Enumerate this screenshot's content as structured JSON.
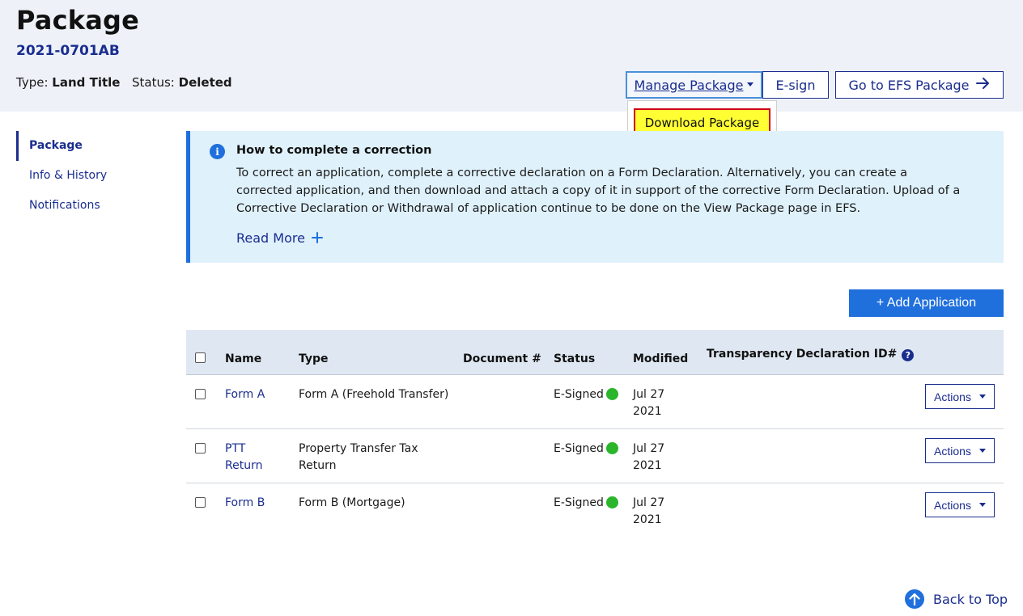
{
  "header": {
    "title": "Package",
    "package_id": "2021-0701AB",
    "type_label": "Type:",
    "type_value": "Land Title",
    "status_label": "Status:",
    "status_value": "Deleted",
    "manage_label": "Manage Package",
    "esign_label": "E-sign",
    "efs_label": "Go to EFS Package",
    "dropdown": {
      "download_label": "Download Package"
    }
  },
  "sidebar": {
    "items": [
      {
        "label": "Package",
        "active": true
      },
      {
        "label": "Info & History",
        "active": false
      },
      {
        "label": "Notifications",
        "active": false
      }
    ]
  },
  "info": {
    "title": "How to complete a correction",
    "body": "To correct an application, complete a corrective declaration on a Form Declaration. Alternatively, you can create a corrected application, and then download and attach a copy of it in support of the corrective Form Declaration. Upload of a Corrective Declaration or Withdrawal of application continue to be done on the View Package page in EFS.",
    "read_more": "Read More"
  },
  "add_application_label": "+ Add Application",
  "table": {
    "headers": {
      "name": "Name",
      "type": "Type",
      "document": "Document #",
      "status": "Status",
      "modified": "Modified",
      "transparency": "Transparency Declaration ID#"
    },
    "rows": [
      {
        "name_line1": "Form A",
        "name_line2": "",
        "type_line1": "Form A (Freehold Transfer)",
        "type_line2": "",
        "document": "",
        "status": "E-Signed",
        "status_color": "#2bb52b",
        "modified_line1": "Jul 27",
        "modified_line2": "2021",
        "actions_label": "Actions"
      },
      {
        "name_line1": "PTT",
        "name_line2": "Return",
        "type_line1": "Property Transfer Tax",
        "type_line2": "Return",
        "document": "",
        "status": "E-Signed",
        "status_color": "#2bb52b",
        "modified_line1": "Jul 27",
        "modified_line2": "2021",
        "actions_label": "Actions"
      },
      {
        "name_line1": "Form B",
        "name_line2": "",
        "type_line1": "Form B (Mortgage)",
        "type_line2": "",
        "document": "",
        "status": "E-Signed",
        "status_color": "#2bb52b",
        "modified_line1": "Jul 27",
        "modified_line2": "2021",
        "actions_label": "Actions"
      }
    ]
  },
  "back_to_top": "Back to Top",
  "icons": {
    "info": "info-circle-icon",
    "help": "question-circle-icon",
    "arrow": "arrow-right-icon",
    "plus": "plus-icon",
    "up": "arrow-up-circle-icon"
  },
  "colors": {
    "brand": "#1a2d8f",
    "accent": "#1f6fdd",
    "signed": "#2bb52b",
    "highlight": "#ffff33"
  }
}
